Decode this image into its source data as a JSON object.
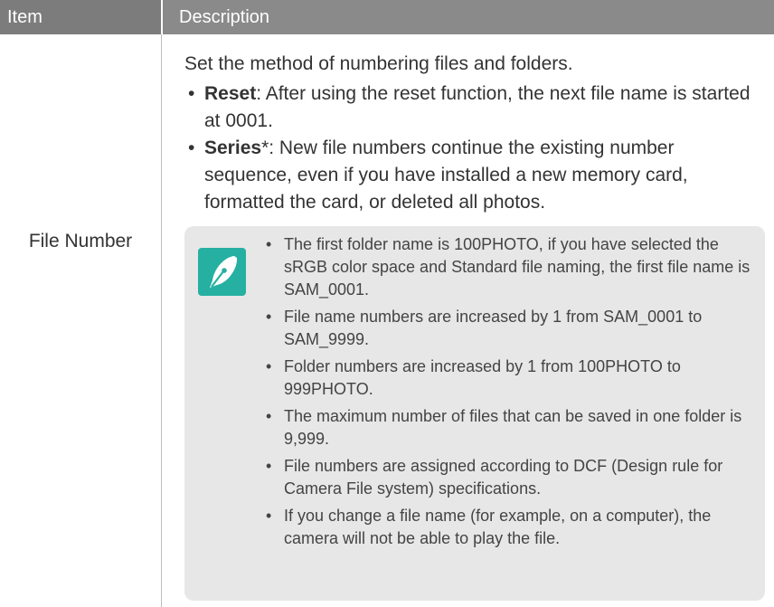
{
  "header": {
    "item": "Item",
    "description": "Description"
  },
  "row": {
    "item": "File Number",
    "intro": "Set the method of numbering files and folders.",
    "options": [
      {
        "term": "Reset",
        "text": ": After using the reset function, the next file name is started at 0001."
      },
      {
        "term": "Series",
        "text": "*: New file numbers continue the existing number sequence, even if you have installed a new memory card, formatted the card, or deleted all photos."
      }
    ],
    "note_icon": "pen-nib-icon",
    "notes": [
      "The first folder name is 100PHOTO, if you have selected the sRGB color space and Standard file naming, the first file name is SAM_0001.",
      "File name numbers are increased by 1 from SAM_0001 to SAM_9999.",
      "Folder numbers are increased by 1 from 100PHOTO to 999PHOTO.",
      "The maximum number of files that can be saved in one folder is 9,999.",
      "File numbers are assigned according to DCF (Design rule for Camera File system) specifications.",
      "If you change a file name (for example, on a computer), the camera will not be able to play the file."
    ]
  },
  "colors": {
    "header_bg": "#7c7c7c",
    "note_bg": "#e7e7e7",
    "icon_bg": "#25b0a1"
  }
}
